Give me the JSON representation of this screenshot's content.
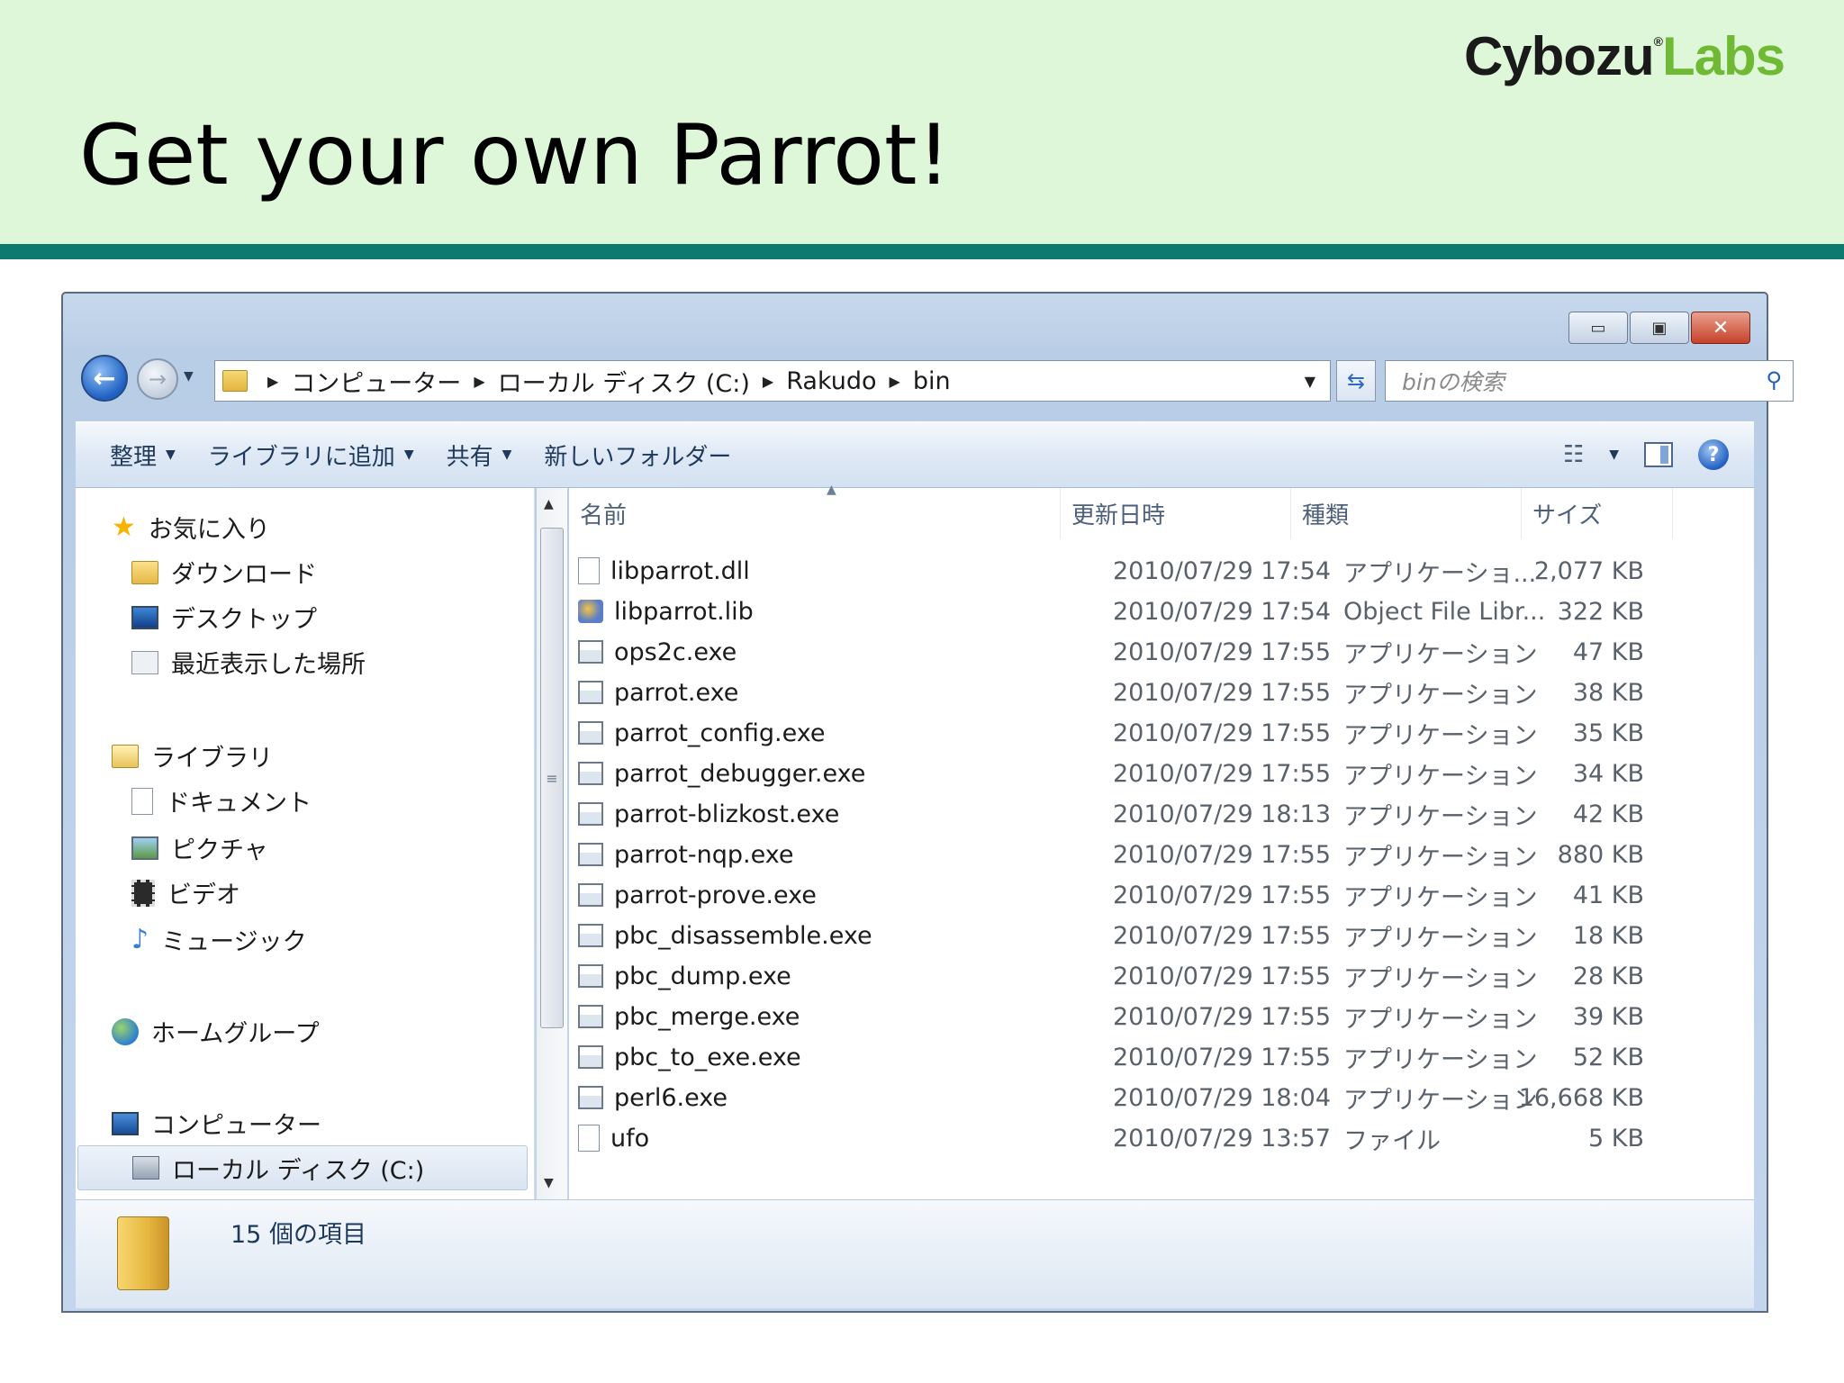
{
  "slide": {
    "title": "Get your own Parrot!",
    "logo": {
      "part1": "Cybozu",
      "reg": "®",
      "part2": "Labs"
    }
  },
  "window": {
    "buttons": {
      "minimize": "▭",
      "maximize": "▣",
      "close": "✕"
    },
    "breadcrumb": [
      "コンピューター",
      "ローカル ディスク (C:)",
      "Rakudo",
      "bin"
    ],
    "search_placeholder": "binの検索"
  },
  "toolbar": {
    "organize": "整理",
    "add_to_library": "ライブラリに追加",
    "share": "共有",
    "new_folder": "新しいフォルダー"
  },
  "nav": {
    "favorites": "お気に入り",
    "downloads": "ダウンロード",
    "desktop": "デスクトップ",
    "recent": "最近表示した場所",
    "libraries": "ライブラリ",
    "documents": "ドキュメント",
    "pictures": "ピクチャ",
    "videos": "ビデオ",
    "music": "ミュージック",
    "homegroup": "ホームグループ",
    "computer": "コンピューター",
    "local_disk": "ローカル ディスク (C:)"
  },
  "columns": {
    "name": "名前",
    "date": "更新日時",
    "type": "種類",
    "size": "サイズ"
  },
  "files": [
    {
      "name": "libparrot.dll",
      "date": "2010/07/29 17:54",
      "type": "アプリケーショ...",
      "size": "2,077 KB",
      "icon": "dll"
    },
    {
      "name": "libparrot.lib",
      "date": "2010/07/29 17:54",
      "type": "Object File Libr...",
      "size": "322 KB",
      "icon": "lib"
    },
    {
      "name": "ops2c.exe",
      "date": "2010/07/29 17:55",
      "type": "アプリケーション",
      "size": "47 KB",
      "icon": "exe"
    },
    {
      "name": "parrot.exe",
      "date": "2010/07/29 17:55",
      "type": "アプリケーション",
      "size": "38 KB",
      "icon": "exe"
    },
    {
      "name": "parrot_config.exe",
      "date": "2010/07/29 17:55",
      "type": "アプリケーション",
      "size": "35 KB",
      "icon": "exe"
    },
    {
      "name": "parrot_debugger.exe",
      "date": "2010/07/29 17:55",
      "type": "アプリケーション",
      "size": "34 KB",
      "icon": "exe"
    },
    {
      "name": "parrot-blizkost.exe",
      "date": "2010/07/29 18:13",
      "type": "アプリケーション",
      "size": "42 KB",
      "icon": "exe"
    },
    {
      "name": "parrot-nqp.exe",
      "date": "2010/07/29 17:55",
      "type": "アプリケーション",
      "size": "880 KB",
      "icon": "exe"
    },
    {
      "name": "parrot-prove.exe",
      "date": "2010/07/29 17:55",
      "type": "アプリケーション",
      "size": "41 KB",
      "icon": "exe"
    },
    {
      "name": "pbc_disassemble.exe",
      "date": "2010/07/29 17:55",
      "type": "アプリケーション",
      "size": "18 KB",
      "icon": "exe"
    },
    {
      "name": "pbc_dump.exe",
      "date": "2010/07/29 17:55",
      "type": "アプリケーション",
      "size": "28 KB",
      "icon": "exe"
    },
    {
      "name": "pbc_merge.exe",
      "date": "2010/07/29 17:55",
      "type": "アプリケーション",
      "size": "39 KB",
      "icon": "exe"
    },
    {
      "name": "pbc_to_exe.exe",
      "date": "2010/07/29 17:55",
      "type": "アプリケーション",
      "size": "52 KB",
      "icon": "exe"
    },
    {
      "name": "perl6.exe",
      "date": "2010/07/29 18:04",
      "type": "アプリケーション",
      "size": "16,668 KB",
      "icon": "exe"
    },
    {
      "name": "ufo",
      "date": "2010/07/29 13:57",
      "type": "ファイル",
      "size": "5 KB",
      "icon": "file"
    }
  ],
  "status": {
    "item_count": "15 個の項目"
  }
}
